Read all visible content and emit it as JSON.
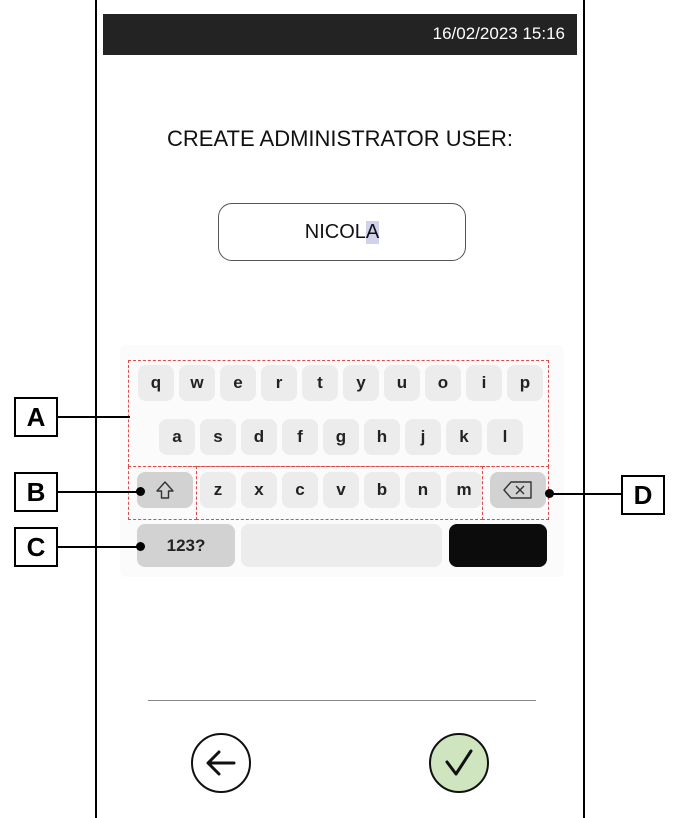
{
  "status_bar": {
    "datetime": "16/02/2023 15:16"
  },
  "title": "CREATE ADMINISTRATOR USER:",
  "name_input": {
    "text_before_caret": "NICOL",
    "text_at_caret": "A"
  },
  "keyboard": {
    "row1": [
      "q",
      "w",
      "e",
      "r",
      "t",
      "y",
      "u",
      "o",
      "i",
      "p"
    ],
    "row2": [
      "a",
      "s",
      "d",
      "f",
      "g",
      "h",
      "j",
      "k",
      "l"
    ],
    "row3": [
      "z",
      "x",
      "c",
      "v",
      "b",
      "n",
      "m"
    ],
    "shift_icon": "shift-arrow-icon",
    "backspace_icon": "backspace-icon",
    "mode_key_label": "123?",
    "space_key_label": "",
    "enter_key_label": ""
  },
  "callouts": {
    "a": "A",
    "b": "B",
    "c": "C",
    "d": "D"
  },
  "footer": {
    "back_icon": "arrow-left-icon",
    "confirm_icon": "checkmark-icon"
  },
  "colors": {
    "status_bar": "#232323",
    "confirm_fill": "#cfe5bf",
    "annotation_dash": "#e04a4a"
  }
}
